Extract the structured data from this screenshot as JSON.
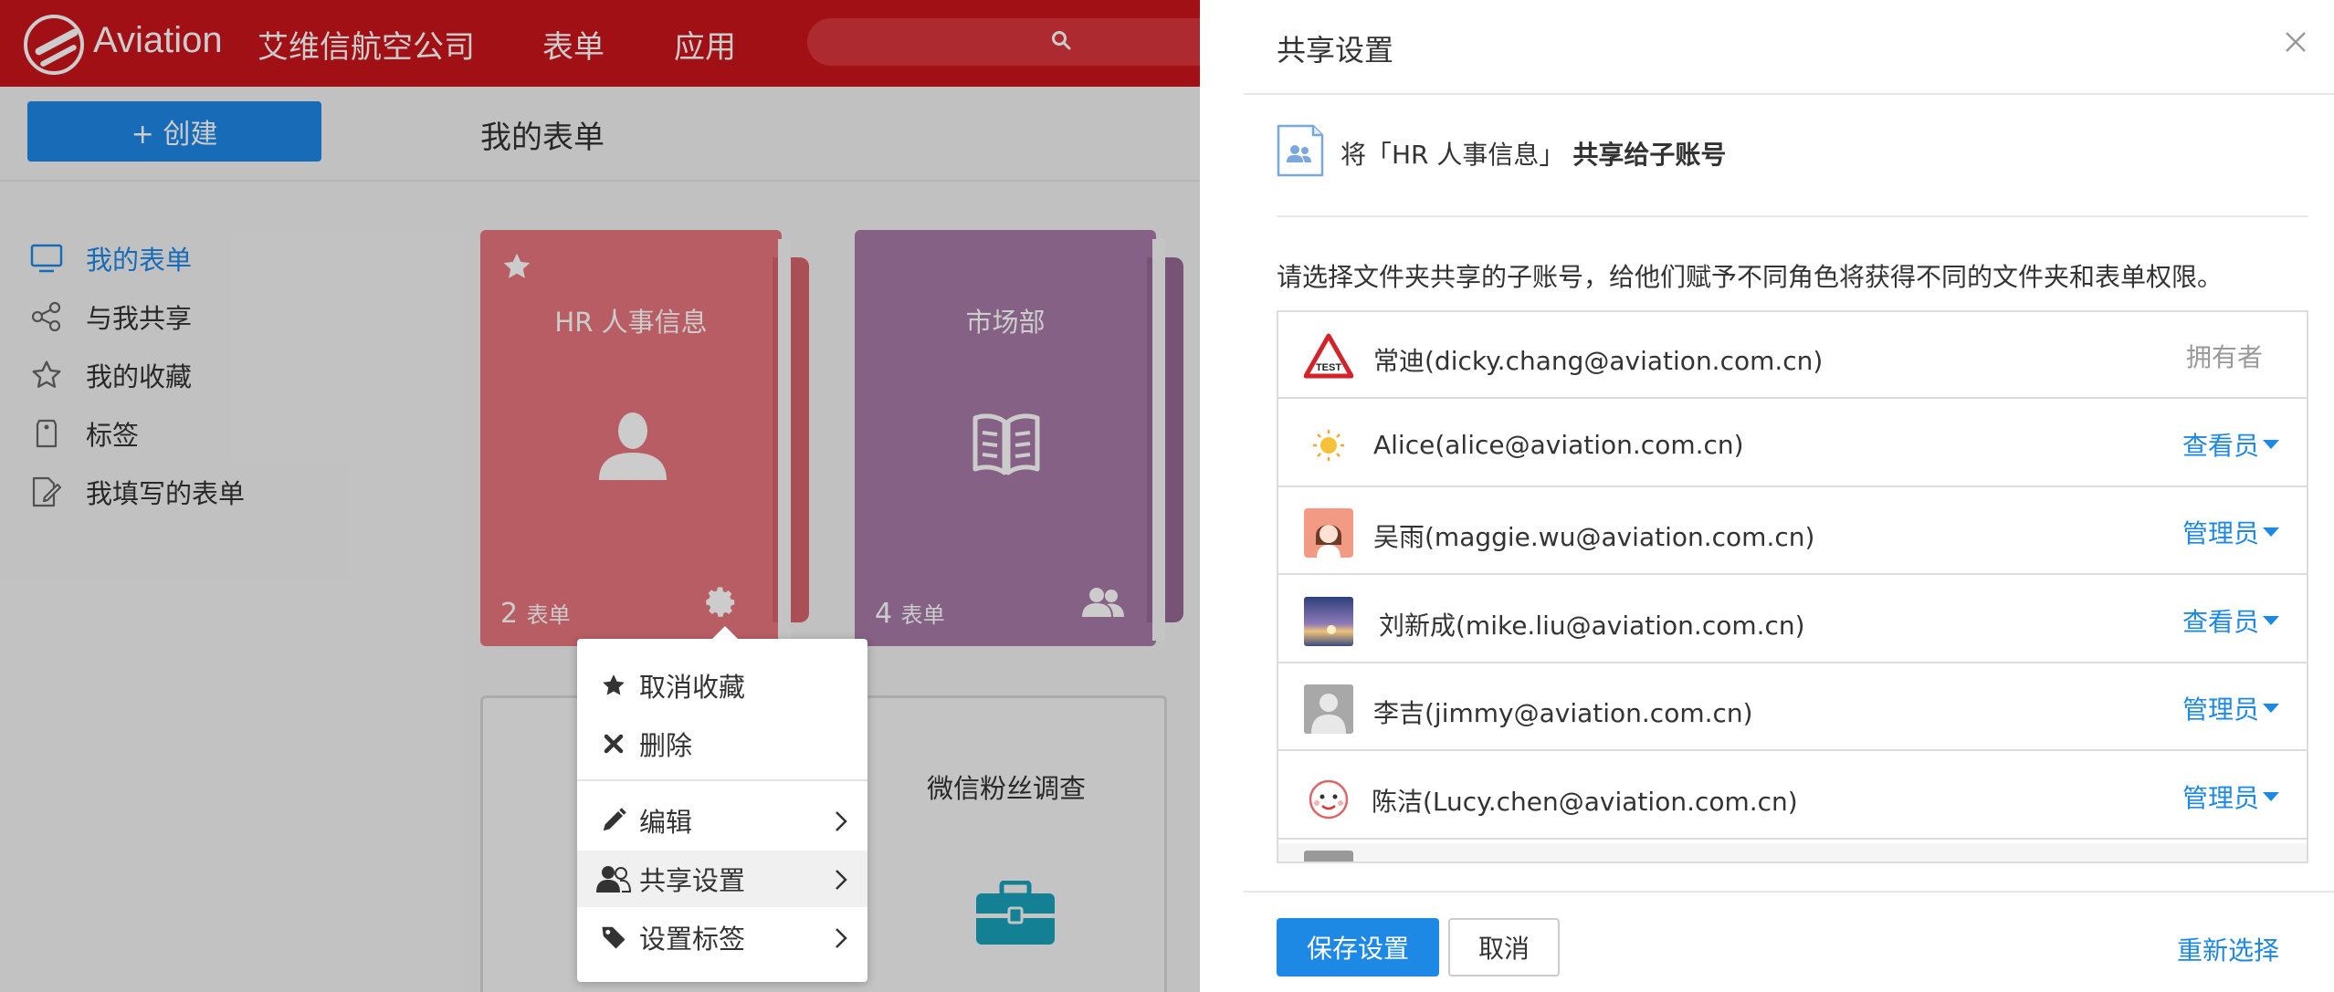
{
  "topbar": {
    "brand": "Aviation",
    "company": "艾维信航空公司",
    "nav": [
      "表单",
      "应用"
    ],
    "search_icon": "search-icon"
  },
  "toolbar": {
    "create_label": "+ 创建",
    "page_title": "我的表单"
  },
  "sidebar": {
    "items": [
      {
        "label": "我的表单",
        "icon": "monitor-icon",
        "active": true
      },
      {
        "label": "与我共享",
        "icon": "share-icon"
      },
      {
        "label": "我的收藏",
        "icon": "star-icon"
      },
      {
        "label": "标签",
        "icon": "tag-icon"
      },
      {
        "label": "我填写的表单",
        "icon": "edit-form-icon"
      }
    ]
  },
  "folders": [
    {
      "title": "HR 人事信息",
      "count": "2",
      "unit": "表单",
      "color": "#e8757d",
      "tab_color": "#d4636b",
      "icon": "person-icon"
    },
    {
      "title": "市场部",
      "count": "4",
      "unit": "表单",
      "color": "#a87aa8",
      "tab_color": "#966896",
      "icon": "book-icon"
    }
  ],
  "form_card": {
    "title": "微信粉丝调查",
    "icon": "briefcase-icon",
    "icon_color": "#1aa0b8"
  },
  "context_menu": {
    "items": [
      {
        "label": "取消收藏",
        "icon": "star-filled-icon"
      },
      {
        "label": "删除",
        "icon": "close-x-icon"
      },
      {
        "label": "编辑",
        "icon": "pencil-icon"
      },
      {
        "label": "共享设置",
        "icon": "users-icon"
      },
      {
        "label": "设置标签",
        "icon": "tag-filled-icon"
      }
    ]
  },
  "dialog": {
    "title": "共享设置",
    "share_prefix": "将「HR 人事信息」",
    "share_bold": "共享给子账号",
    "instruction": "请选择文件夹共享的子账号，给他们赋予不同角色将获得不同的文件夹和表单权限。",
    "users": [
      {
        "name": "常迪(dicky.chang@aviation.com.cn)",
        "role": "拥有者",
        "owner": true,
        "avatar": "test-sign-avatar"
      },
      {
        "name": "Alice(alice@aviation.com.cn)",
        "role": "查看员",
        "avatar": "sun-avatar"
      },
      {
        "name": "吴雨(maggie.wu@aviation.com.cn)",
        "role": "管理员",
        "avatar": "girl-avatar"
      },
      {
        "name": "刘新成(mike.liu@aviation.com.cn)",
        "role": "查看员",
        "avatar": "sunset-avatar"
      },
      {
        "name": "李吉(jimmy@aviation.com.cn)",
        "role": "管理员",
        "avatar": "default-avatar"
      },
      {
        "name": "陈洁(Lucy.chen@aviation.com.cn)",
        "role": "管理员",
        "avatar": "cartoon-avatar"
      }
    ],
    "save_label": "保存设置",
    "cancel_label": "取消",
    "reselect_label": "重新选择",
    "accent": "#1e88e5"
  }
}
